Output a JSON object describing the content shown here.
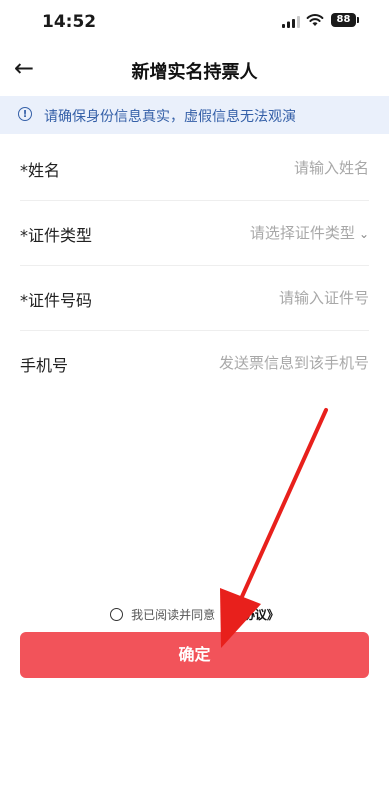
{
  "status_bar": {
    "time": "14:52",
    "battery": "88"
  },
  "header": {
    "back_icon": "arrow-left-icon",
    "title": "新增实名持票人"
  },
  "notice": {
    "icon": "info-circle-icon",
    "text": "请确保身份信息真实，虚假信息无法观演"
  },
  "form": {
    "name": {
      "label": "*姓名",
      "placeholder": "请输入姓名",
      "value": ""
    },
    "id_type": {
      "label": "*证件类型",
      "placeholder": "请选择证件类型"
    },
    "id_number": {
      "label": "*证件号码",
      "placeholder": "请输入证件号",
      "value": ""
    },
    "phone": {
      "label": "手机号",
      "placeholder": "发送票信息到该手机号",
      "value": ""
    }
  },
  "agreement": {
    "text": "我已阅读并同意",
    "link": "《…协议》",
    "checked": false
  },
  "confirm_button": {
    "label": "确定",
    "color": "#f2535a"
  },
  "annotation": {
    "arrow_color": "#e8201c"
  }
}
